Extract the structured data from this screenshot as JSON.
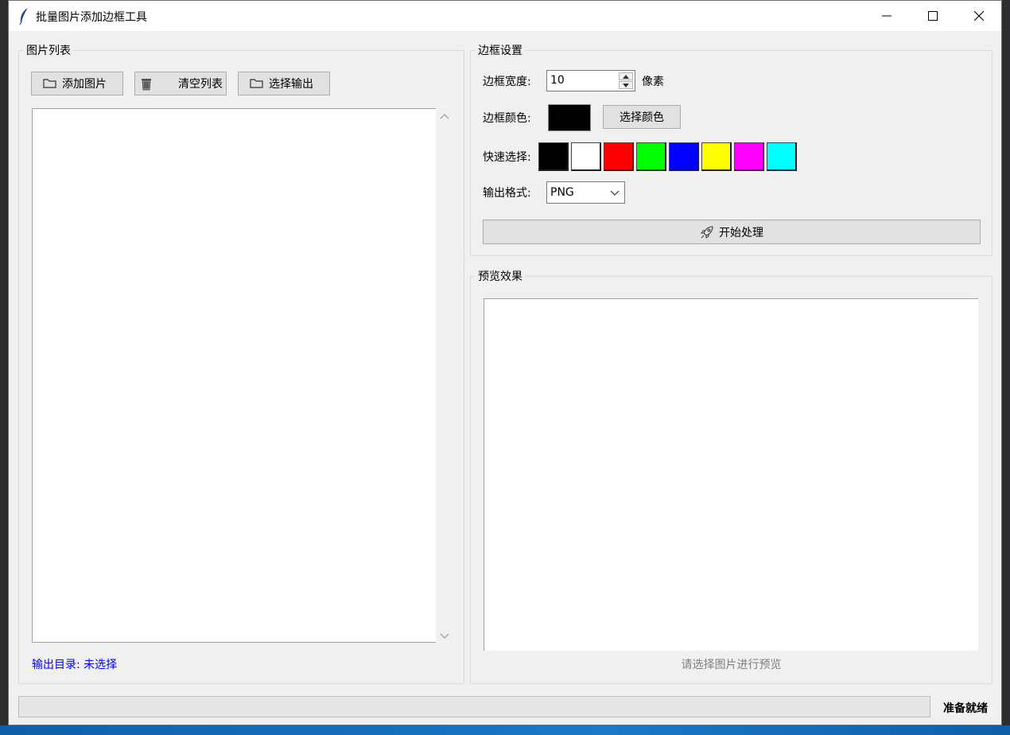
{
  "window": {
    "title": "批量图片添加边框工具",
    "controls": {
      "minimize": "minimize-icon",
      "maximize": "maximize-icon",
      "close": "close-icon"
    }
  },
  "image_list": {
    "title": "图片列表",
    "buttons": {
      "add_images": "添加图片",
      "clear_list": "清空列表",
      "select_output": "选择输出"
    },
    "items": [],
    "output_dir_label": "输出目录: 未选择"
  },
  "border_settings": {
    "title": "边框设置",
    "width_label": "边框宽度:",
    "width_value": "10",
    "width_unit": "像素",
    "color_label": "边框颜色:",
    "current_color": "#000000",
    "choose_color_button": "选择颜色",
    "quick_select_label": "快速选择:",
    "quick_colors": [
      "#000000",
      "#ffffff",
      "#ff0000",
      "#00ff00",
      "#0000ff",
      "#ffff00",
      "#ff00ff",
      "#00ffff"
    ],
    "format_label": "输出格式:",
    "format_value": "PNG",
    "start_button": "开始处理"
  },
  "preview": {
    "title": "预览效果",
    "placeholder": "请选择图片进行预览"
  },
  "status": {
    "progress": 0,
    "text": "准备就绪"
  },
  "colors": {
    "output_dir_text": "#0000ff",
    "placeholder_text": "#808080",
    "window_bg": "#f0f0f0"
  }
}
